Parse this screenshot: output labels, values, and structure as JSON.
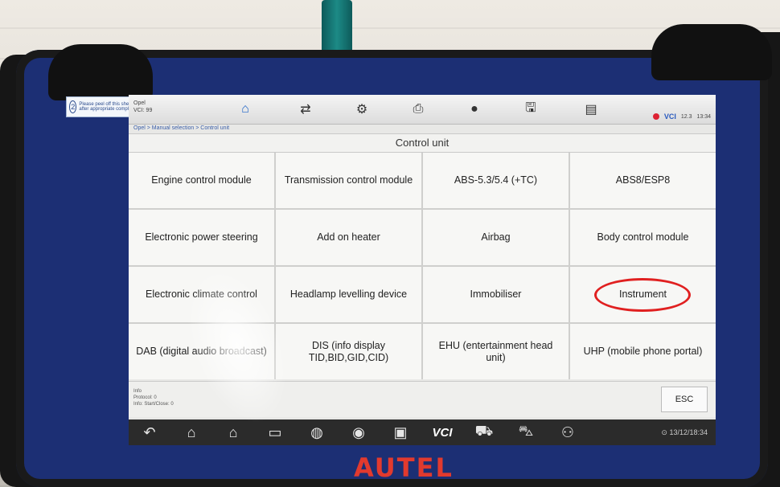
{
  "sticker": {
    "step": "2",
    "text": "Please peel off this sheet after appropriate completion"
  },
  "vehicle": {
    "make": "Opel",
    "line2": "VCI: 99"
  },
  "breadcrumb": "Opel > Manual selection > Control unit",
  "toolbar": {
    "items": [
      {
        "name": "home-icon",
        "glyph": "⌂"
      },
      {
        "name": "vehicle-swap-icon",
        "glyph": "⇄"
      },
      {
        "name": "settings-icon",
        "glyph": "⚙"
      },
      {
        "name": "print-icon",
        "glyph": "⎙"
      },
      {
        "name": "help-icon",
        "glyph": "●"
      },
      {
        "name": "save-icon",
        "glyph": "🖫"
      },
      {
        "name": "message-icon",
        "glyph": "▤"
      }
    ]
  },
  "status": {
    "vci": "VCI",
    "battery": "12.3",
    "time": "13:34"
  },
  "page_title": "Control unit",
  "modules": [
    "Engine control module",
    "Transmission control module",
    "ABS-5.3/5.4 (+TC)",
    "ABS8/ESP8",
    "Electronic power steering",
    "Add on heater",
    "Airbag",
    "Body control module",
    "Electronic climate control",
    "Headlamp levelling device",
    "Immobiliser",
    "Instrument",
    "DAB (digital audio broadcast)",
    "DIS (info display TID,BID,GID,CID)",
    "EHU (entertainment head unit)",
    "UHP (mobile phone portal)"
  ],
  "footer": {
    "line1": "Info",
    "line2": "Protocol: 0",
    "line3": "Info: Start/Close: 0",
    "esc": "ESC"
  },
  "navbar": {
    "items": [
      {
        "name": "back-icon",
        "glyph": "↶"
      },
      {
        "name": "home-nav-icon",
        "glyph": "⌂"
      },
      {
        "name": "desktop-icon",
        "glyph": "⌂"
      },
      {
        "name": "recent-apps-icon",
        "glyph": "▭"
      },
      {
        "name": "browser-icon",
        "glyph": "◍"
      },
      {
        "name": "camera-icon",
        "glyph": "◉"
      },
      {
        "name": "display-icon",
        "glyph": "▣"
      },
      {
        "name": "vci-icon",
        "glyph": "VCI"
      },
      {
        "name": "vehicle-icon",
        "glyph": "⛟"
      },
      {
        "name": "car-icon",
        "glyph": "⛍"
      },
      {
        "name": "user-icon",
        "glyph": "⚇"
      }
    ],
    "status": "⊙ 13/12/18:34"
  },
  "brand": "AUTEL",
  "colors": {
    "device_blue": "#1c2f74",
    "highlight_circle": "#e02020",
    "brand_red": "#e23a2e"
  }
}
